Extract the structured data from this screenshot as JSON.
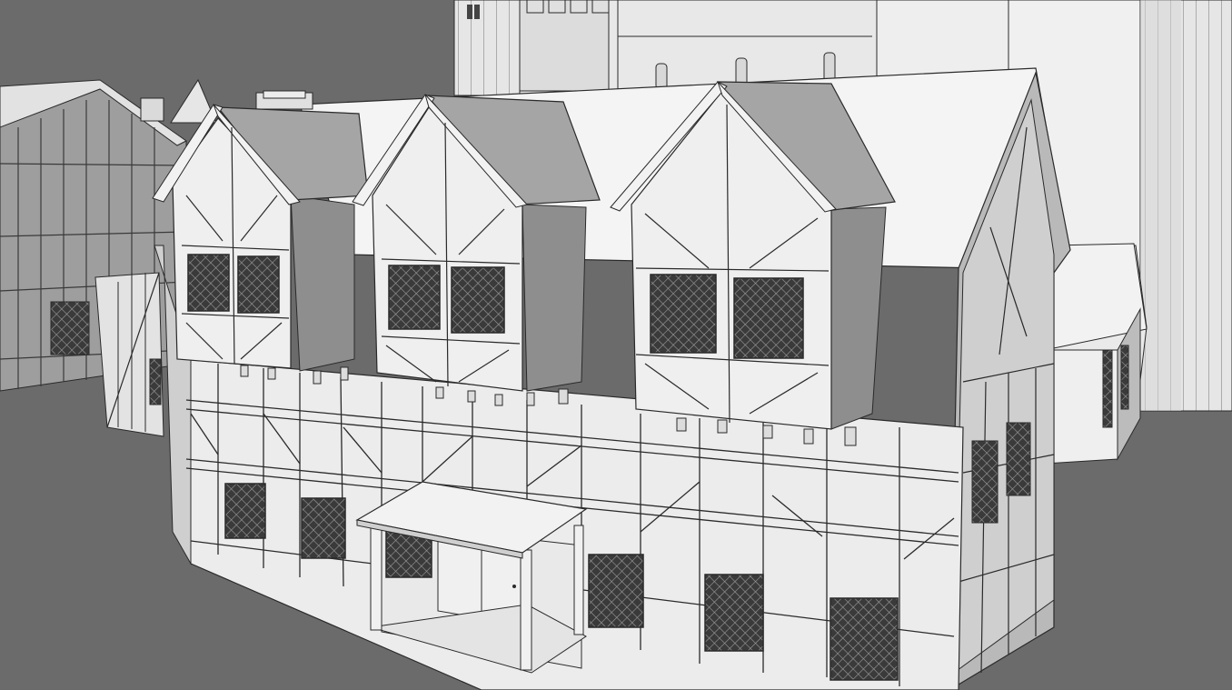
{
  "viewport": {
    "kind": "3D modeling viewport (solid shading with wireframe overlay)",
    "background_color": "#6b6b6b",
    "model_color": "#e8e8e8",
    "shadow_color": "#9a9a9a",
    "edge_color": "#2a2a2a",
    "objects": [
      "castle-keep",
      "round-tower-left",
      "round-tower-right",
      "background-house-left",
      "small-side-house",
      "tudor-house-main",
      "dormer-left",
      "dormer-middle",
      "dormer-right",
      "entrance-porch",
      "chimney",
      "stair-railing"
    ]
  }
}
